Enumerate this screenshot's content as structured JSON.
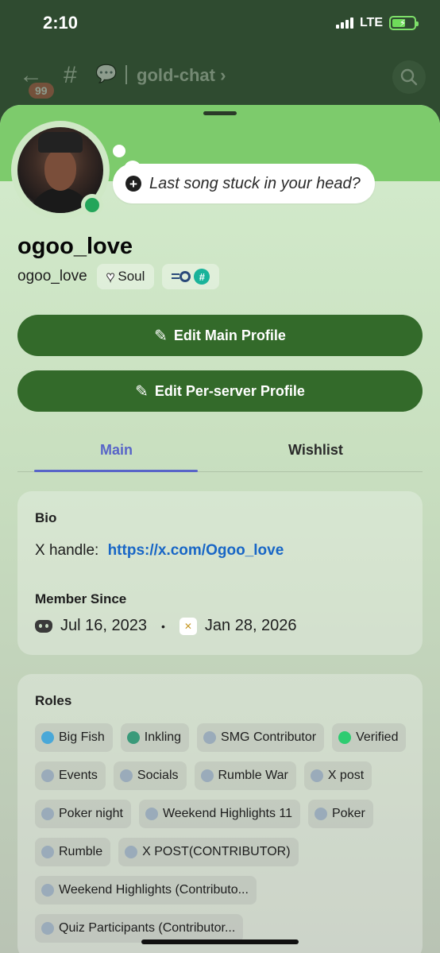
{
  "status_bar": {
    "time": "2:10",
    "network": "LTE"
  },
  "channel_header": {
    "badge": "99",
    "channel_name": "gold-chat"
  },
  "profile": {
    "status_prompt": "Last song stuck in your head?",
    "display_name": "ogoo_love",
    "username": "ogoo_love",
    "badge_label": "Soul"
  },
  "buttons": {
    "edit_main": "Edit Main Profile",
    "edit_server": "Edit Per-server Profile"
  },
  "tabs": {
    "main": "Main",
    "wishlist": "Wishlist"
  },
  "bio": {
    "title": "Bio",
    "label": "X handle:",
    "link": "https://x.com/Ogoo_love"
  },
  "member_since": {
    "title": "Member Since",
    "discord_date": "Jul 16, 2023",
    "separator": "•",
    "server_date": "Jan 28, 2026"
  },
  "roles": {
    "title": "Roles",
    "items": [
      {
        "label": "Big Fish",
        "color": "#4aa8d8"
      },
      {
        "label": "Inkling",
        "color": "#3a9a7a"
      },
      {
        "label": "SMG Contributor",
        "color": "#9aabba"
      },
      {
        "label": "Verified",
        "color": "#2ecc71"
      },
      {
        "label": "Events",
        "color": "#9aabba"
      },
      {
        "label": "Socials",
        "color": "#9aabba"
      },
      {
        "label": "Rumble War",
        "color": "#9aabba"
      },
      {
        "label": "X post",
        "color": "#9aabba"
      },
      {
        "label": "Poker night",
        "color": "#9aabba"
      },
      {
        "label": "Weekend Highlights 11",
        "color": "#9aabba"
      },
      {
        "label": "Poker",
        "color": "#9aabba"
      },
      {
        "label": "Rumble",
        "color": "#9aabba"
      },
      {
        "label": "X POST(CONTRIBUTOR)",
        "color": "#9aabba"
      },
      {
        "label": "Weekend Highlights (Contributo...",
        "color": "#9aabba"
      },
      {
        "label": "Quiz Participants (Contributor...",
        "color": "#9aabba"
      }
    ]
  },
  "colors": {
    "banner": "#7dcb6c",
    "primary_button": "#336a2a",
    "tab_active": "#5865c8",
    "link": "#1866c6",
    "online": "#23a55a"
  }
}
